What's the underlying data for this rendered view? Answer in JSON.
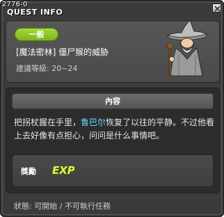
{
  "window": {
    "quest_id": "2776-0",
    "title": "QUEST INFO"
  },
  "header": {
    "category": "一般",
    "quest_name": "[魔法密林] 僵尸猴的威胁",
    "level_range": "建議等級: 20~24"
  },
  "content": {
    "section_title": "內容",
    "description_part1": "把拐杖握在手里，",
    "npc_name": "鲁巴尔",
    "description_part2": "恢复了以往的平静。不过他看上去好像有点担心，问问是什么事情吧。"
  },
  "reward": {
    "label": "獎勵",
    "icon_text": "EXP"
  },
  "status": {
    "text": "狀態:  可開始 / 不可執行任務"
  },
  "colors": {
    "window_bg": "#3b3b3b",
    "badge_green": "#8cc428",
    "npc_highlight": "#6fd7ff",
    "exp_yellow": "#e8f040"
  }
}
